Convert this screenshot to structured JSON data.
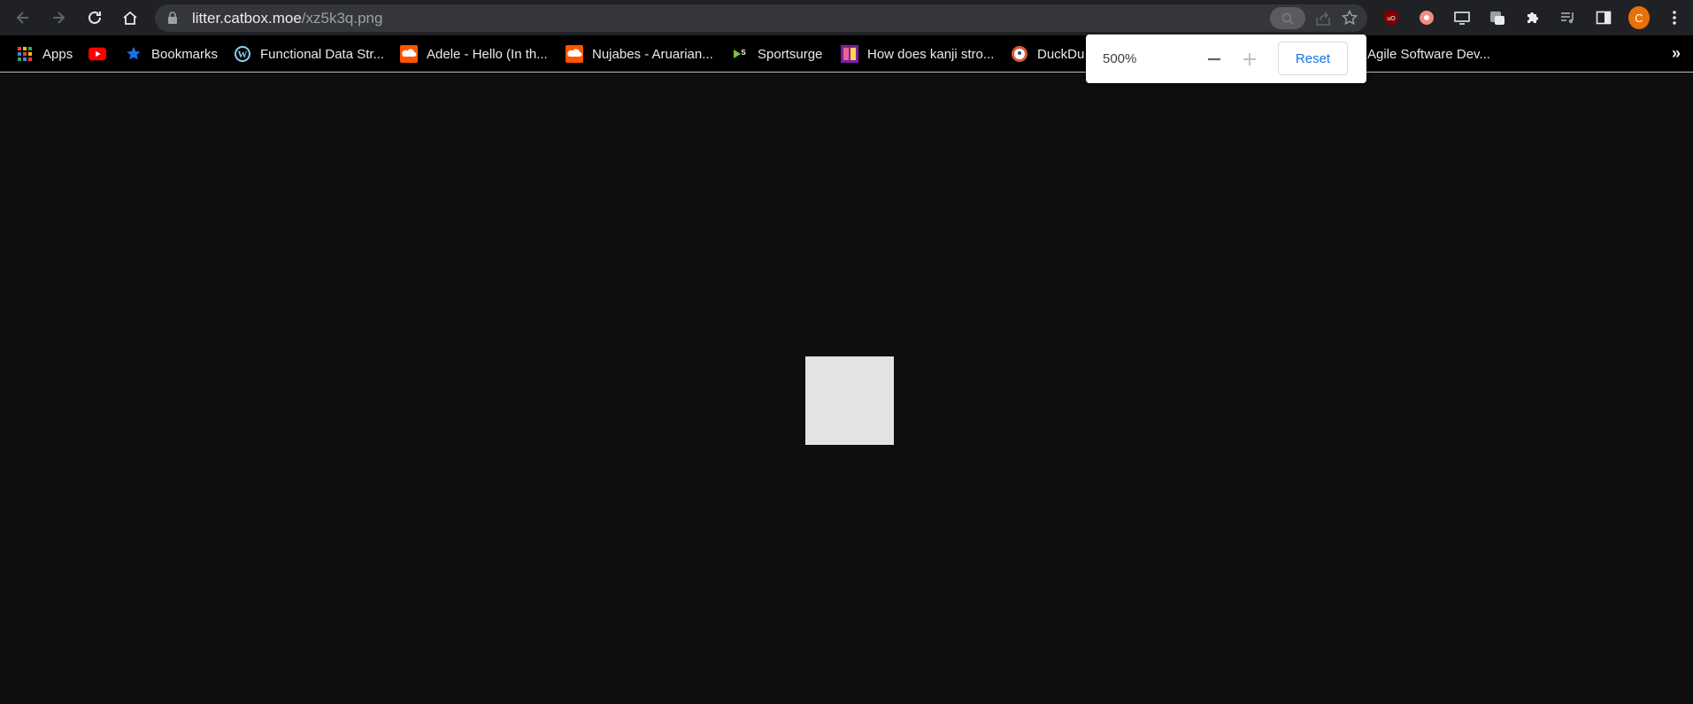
{
  "toolbar": {
    "url_domain": "litter.catbox.moe",
    "url_path": "/xz5k3q.png",
    "profile_initial": "C"
  },
  "bookmarks": [
    {
      "label": "Apps",
      "icon": "apps-grid-icon"
    },
    {
      "label": "",
      "icon": "youtube-icon"
    },
    {
      "label": "Bookmarks",
      "icon": "star-icon"
    },
    {
      "label": "Functional Data Str...",
      "icon": "wordpress-icon"
    },
    {
      "label": "Adele - Hello (In th...",
      "icon": "soundcloud-icon"
    },
    {
      "label": "Nujabes - Aruarian...",
      "icon": "soundcloud-icon"
    },
    {
      "label": "Sportsurge",
      "icon": "sportsurge-icon"
    },
    {
      "label": "How does kanji stro...",
      "icon": "kanji-site-icon"
    },
    {
      "label": "DuckDu",
      "icon": "duckduckgo-icon"
    },
    {
      "label": "Agile Software Dev...",
      "icon": "page-icon"
    }
  ],
  "zoom_popup": {
    "level": "500%",
    "reset_label": "Reset"
  },
  "colors": {
    "page_background": "#0e0e0e",
    "image_fill": "#e3e3e3",
    "accent_blue": "#1a73e8",
    "profile_orange": "#e8710a"
  }
}
